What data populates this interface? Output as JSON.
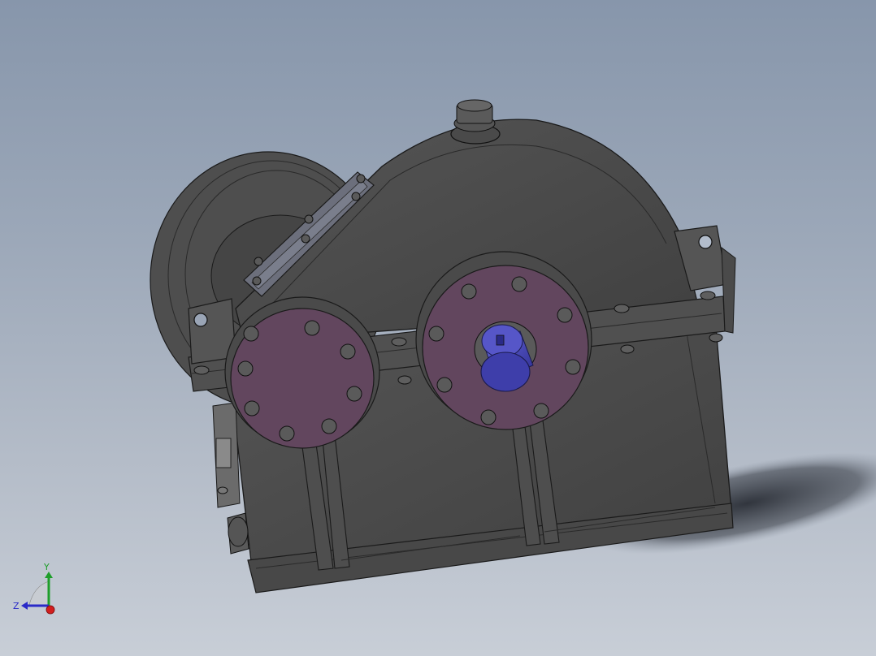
{
  "viewport": {
    "background_top": "#8796ab",
    "background_bottom": "#c8ced7"
  },
  "model": {
    "body_color": "#4a4a4a",
    "edge_color": "#1a1a1a",
    "bearing_cap_color": "#62465e",
    "shaft_color": "#4a4ab8",
    "shadow_color": "#2a2e36"
  },
  "triad": {
    "x_label": "",
    "y_label": "Y",
    "z_label": "Z",
    "x_color": "#d21e1e",
    "y_color": "#1e9e2a",
    "z_color": "#2a2ac8"
  }
}
